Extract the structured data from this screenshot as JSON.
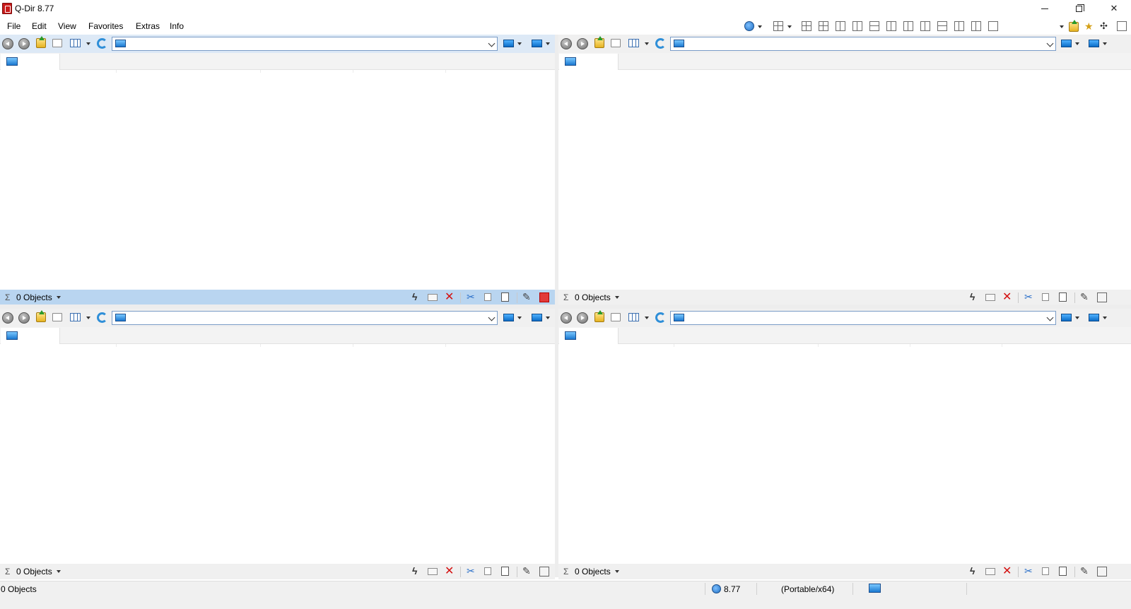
{
  "window": {
    "title": "Q-Dir 8.77",
    "minimize_glyph": "—",
    "close_glyph": "✕"
  },
  "menu": {
    "items": [
      "File",
      "Edit",
      "View",
      "Favorites",
      "Extras",
      "Info"
    ]
  },
  "panes": [
    {
      "object_count": "0 Objects",
      "active": true
    },
    {
      "object_count": "0 Objects",
      "active": false
    },
    {
      "object_count": "0 Objects",
      "active": false
    },
    {
      "object_count": "0 Objects",
      "active": false
    }
  ],
  "pane_status_glyphs": {
    "sigma": "Σ",
    "flash": "ϟ",
    "delete": "✕",
    "cut": "✂",
    "edit": "✎"
  },
  "statusbar": {
    "objects": "0 Objects",
    "version": "8.77",
    "edition": "(Portable/x64)"
  },
  "colors": {
    "active_pane_status": "#b9d5f0",
    "delete_red": "#d41111",
    "accent_blue": "#1b78d0"
  },
  "icons": {
    "toolbar": [
      "globe-icon",
      "layout-icon",
      "back-icon",
      "forward-icon",
      "up-folder-icon",
      "new-folder-icon",
      "view-mode-icon",
      "refresh-icon",
      "computer-icon",
      "monitor-icon"
    ],
    "status": [
      "sigma-icon",
      "flash-icon",
      "mail-icon",
      "delete-icon",
      "cut-icon",
      "copy-icon",
      "paste-icon",
      "edit-icon",
      "close-pane-icon"
    ]
  }
}
